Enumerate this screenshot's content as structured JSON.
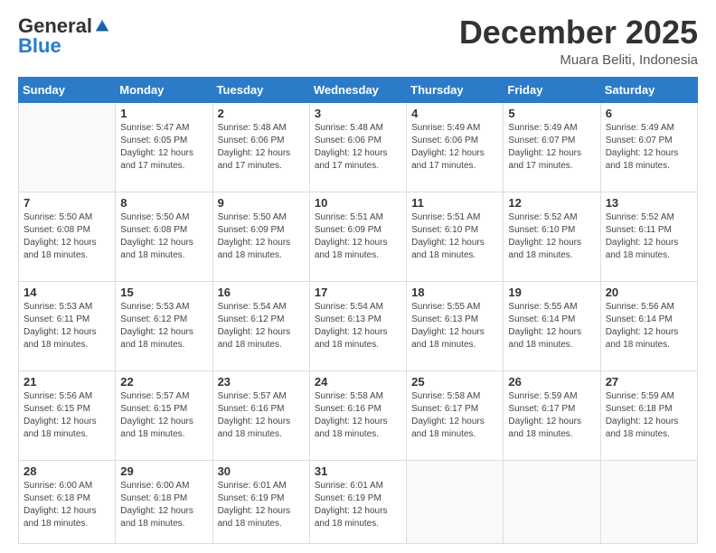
{
  "logo": {
    "general": "General",
    "blue": "Blue"
  },
  "header": {
    "month": "December 2025",
    "location": "Muara Beliti, Indonesia"
  },
  "weekdays": [
    "Sunday",
    "Monday",
    "Tuesday",
    "Wednesday",
    "Thursday",
    "Friday",
    "Saturday"
  ],
  "rows": [
    [
      {
        "day": "",
        "sunrise": "",
        "sunset": "",
        "daylight": ""
      },
      {
        "day": "1",
        "sunrise": "Sunrise: 5:47 AM",
        "sunset": "Sunset: 6:05 PM",
        "daylight": "Daylight: 12 hours and 17 minutes."
      },
      {
        "day": "2",
        "sunrise": "Sunrise: 5:48 AM",
        "sunset": "Sunset: 6:06 PM",
        "daylight": "Daylight: 12 hours and 17 minutes."
      },
      {
        "day": "3",
        "sunrise": "Sunrise: 5:48 AM",
        "sunset": "Sunset: 6:06 PM",
        "daylight": "Daylight: 12 hours and 17 minutes."
      },
      {
        "day": "4",
        "sunrise": "Sunrise: 5:49 AM",
        "sunset": "Sunset: 6:06 PM",
        "daylight": "Daylight: 12 hours and 17 minutes."
      },
      {
        "day": "5",
        "sunrise": "Sunrise: 5:49 AM",
        "sunset": "Sunset: 6:07 PM",
        "daylight": "Daylight: 12 hours and 17 minutes."
      },
      {
        "day": "6",
        "sunrise": "Sunrise: 5:49 AM",
        "sunset": "Sunset: 6:07 PM",
        "daylight": "Daylight: 12 hours and 18 minutes."
      }
    ],
    [
      {
        "day": "7",
        "sunrise": "Sunrise: 5:50 AM",
        "sunset": "Sunset: 6:08 PM",
        "daylight": "Daylight: 12 hours and 18 minutes."
      },
      {
        "day": "8",
        "sunrise": "Sunrise: 5:50 AM",
        "sunset": "Sunset: 6:08 PM",
        "daylight": "Daylight: 12 hours and 18 minutes."
      },
      {
        "day": "9",
        "sunrise": "Sunrise: 5:50 AM",
        "sunset": "Sunset: 6:09 PM",
        "daylight": "Daylight: 12 hours and 18 minutes."
      },
      {
        "day": "10",
        "sunrise": "Sunrise: 5:51 AM",
        "sunset": "Sunset: 6:09 PM",
        "daylight": "Daylight: 12 hours and 18 minutes."
      },
      {
        "day": "11",
        "sunrise": "Sunrise: 5:51 AM",
        "sunset": "Sunset: 6:10 PM",
        "daylight": "Daylight: 12 hours and 18 minutes."
      },
      {
        "day": "12",
        "sunrise": "Sunrise: 5:52 AM",
        "sunset": "Sunset: 6:10 PM",
        "daylight": "Daylight: 12 hours and 18 minutes."
      },
      {
        "day": "13",
        "sunrise": "Sunrise: 5:52 AM",
        "sunset": "Sunset: 6:11 PM",
        "daylight": "Daylight: 12 hours and 18 minutes."
      }
    ],
    [
      {
        "day": "14",
        "sunrise": "Sunrise: 5:53 AM",
        "sunset": "Sunset: 6:11 PM",
        "daylight": "Daylight: 12 hours and 18 minutes."
      },
      {
        "day": "15",
        "sunrise": "Sunrise: 5:53 AM",
        "sunset": "Sunset: 6:12 PM",
        "daylight": "Daylight: 12 hours and 18 minutes."
      },
      {
        "day": "16",
        "sunrise": "Sunrise: 5:54 AM",
        "sunset": "Sunset: 6:12 PM",
        "daylight": "Daylight: 12 hours and 18 minutes."
      },
      {
        "day": "17",
        "sunrise": "Sunrise: 5:54 AM",
        "sunset": "Sunset: 6:13 PM",
        "daylight": "Daylight: 12 hours and 18 minutes."
      },
      {
        "day": "18",
        "sunrise": "Sunrise: 5:55 AM",
        "sunset": "Sunset: 6:13 PM",
        "daylight": "Daylight: 12 hours and 18 minutes."
      },
      {
        "day": "19",
        "sunrise": "Sunrise: 5:55 AM",
        "sunset": "Sunset: 6:14 PM",
        "daylight": "Daylight: 12 hours and 18 minutes."
      },
      {
        "day": "20",
        "sunrise": "Sunrise: 5:56 AM",
        "sunset": "Sunset: 6:14 PM",
        "daylight": "Daylight: 12 hours and 18 minutes."
      }
    ],
    [
      {
        "day": "21",
        "sunrise": "Sunrise: 5:56 AM",
        "sunset": "Sunset: 6:15 PM",
        "daylight": "Daylight: 12 hours and 18 minutes."
      },
      {
        "day": "22",
        "sunrise": "Sunrise: 5:57 AM",
        "sunset": "Sunset: 6:15 PM",
        "daylight": "Daylight: 12 hours and 18 minutes."
      },
      {
        "day": "23",
        "sunrise": "Sunrise: 5:57 AM",
        "sunset": "Sunset: 6:16 PM",
        "daylight": "Daylight: 12 hours and 18 minutes."
      },
      {
        "day": "24",
        "sunrise": "Sunrise: 5:58 AM",
        "sunset": "Sunset: 6:16 PM",
        "daylight": "Daylight: 12 hours and 18 minutes."
      },
      {
        "day": "25",
        "sunrise": "Sunrise: 5:58 AM",
        "sunset": "Sunset: 6:17 PM",
        "daylight": "Daylight: 12 hours and 18 minutes."
      },
      {
        "day": "26",
        "sunrise": "Sunrise: 5:59 AM",
        "sunset": "Sunset: 6:17 PM",
        "daylight": "Daylight: 12 hours and 18 minutes."
      },
      {
        "day": "27",
        "sunrise": "Sunrise: 5:59 AM",
        "sunset": "Sunset: 6:18 PM",
        "daylight": "Daylight: 12 hours and 18 minutes."
      }
    ],
    [
      {
        "day": "28",
        "sunrise": "Sunrise: 6:00 AM",
        "sunset": "Sunset: 6:18 PM",
        "daylight": "Daylight: 12 hours and 18 minutes."
      },
      {
        "day": "29",
        "sunrise": "Sunrise: 6:00 AM",
        "sunset": "Sunset: 6:18 PM",
        "daylight": "Daylight: 12 hours and 18 minutes."
      },
      {
        "day": "30",
        "sunrise": "Sunrise: 6:01 AM",
        "sunset": "Sunset: 6:19 PM",
        "daylight": "Daylight: 12 hours and 18 minutes."
      },
      {
        "day": "31",
        "sunrise": "Sunrise: 6:01 AM",
        "sunset": "Sunset: 6:19 PM",
        "daylight": "Daylight: 12 hours and 18 minutes."
      },
      {
        "day": "",
        "sunrise": "",
        "sunset": "",
        "daylight": ""
      },
      {
        "day": "",
        "sunrise": "",
        "sunset": "",
        "daylight": ""
      },
      {
        "day": "",
        "sunrise": "",
        "sunset": "",
        "daylight": ""
      }
    ]
  ]
}
